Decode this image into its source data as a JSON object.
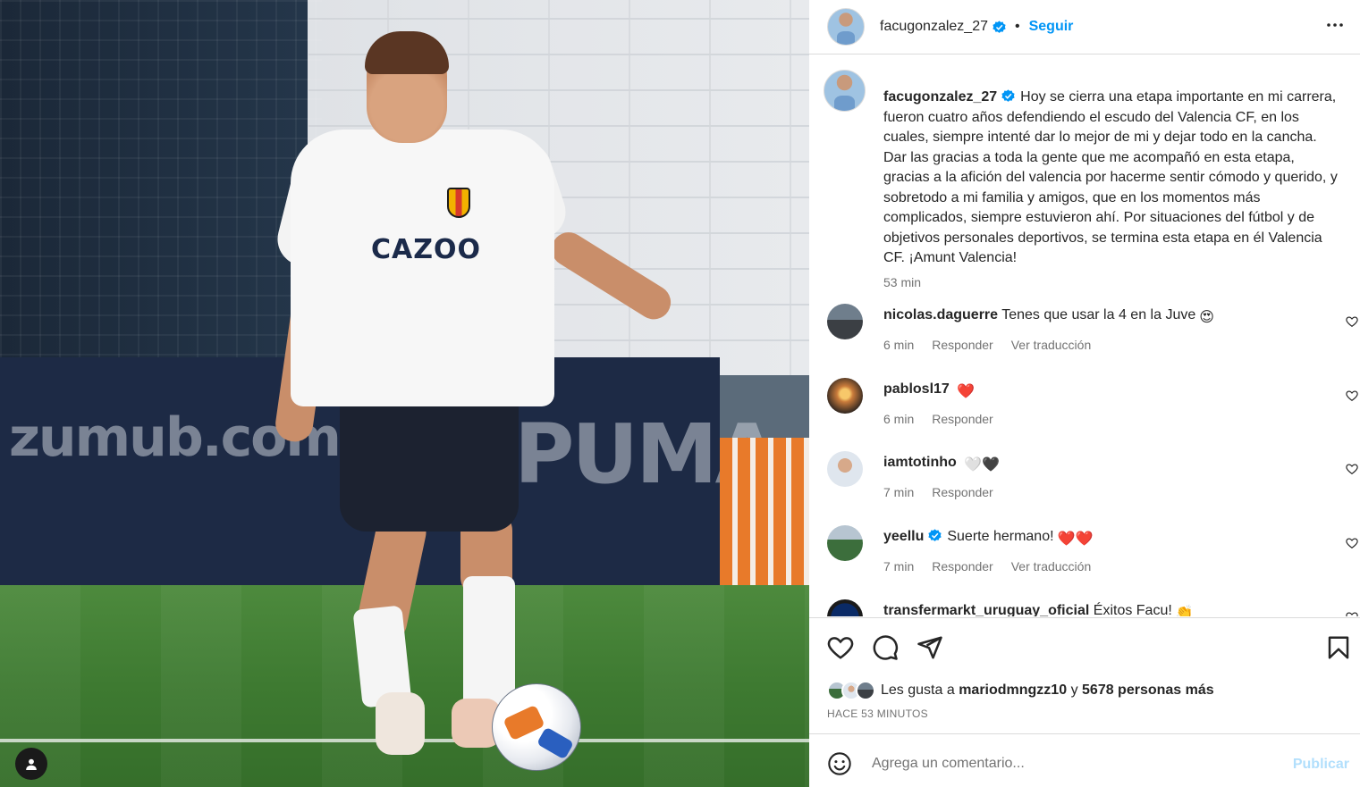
{
  "post": {
    "username": "facugonzalez_27",
    "follow_label": "Seguir",
    "separator": "•",
    "caption": "Hoy se cierra una etapa importante en mi carrera, fueron cuatro años defendiendo el escudo del Valencia CF, en los cuales, siempre intenté dar lo mejor de mi y dejar todo en la cancha. Dar las gracias a toda la gente que me acompañó en esta etapa, gracias a la afición del valencia por hacerme sentir cómodo y querido, y sobretodo a mi familia y amigos, que en los momentos más complicados, siempre estuvieron ahí. Por situaciones del fútbol y de objetivos personales deportivos, se termina esta etapa en él Valencia CF. ¡Amunt Valencia!",
    "caption_time": "53 min"
  },
  "photo": {
    "sponsor": "CAZOO",
    "ad_left": "zumub.com",
    "ad_right": "PUMA"
  },
  "comments": [
    {
      "username": "nicolas.daguerre",
      "text": "Tenes que usar la 4 en la Juve",
      "emoji": "😍",
      "time": "6 min",
      "reply": "Responder",
      "translate": "Ver traducción",
      "verified": false
    },
    {
      "username": "pablosl17",
      "text": "",
      "emoji": "❤️",
      "time": "6 min",
      "reply": "Responder",
      "translate": "",
      "verified": false
    },
    {
      "username": "iamtotinho",
      "text": "",
      "emoji": "🤍🖤",
      "time": "7 min",
      "reply": "Responder",
      "translate": "",
      "verified": false
    },
    {
      "username": "yeellu",
      "text": "Suerte hermano!",
      "emoji": "❤️❤️",
      "time": "7 min",
      "reply": "Responder",
      "translate": "Ver traducción",
      "verified": true
    },
    {
      "username": "transfermarkt_uruguay_oficial",
      "text": "Éxitos Facu!",
      "emoji": "👏",
      "time": "",
      "reply": "",
      "translate": "",
      "verified": false
    }
  ],
  "likes": {
    "prefix": "Les gusta a",
    "user": "mariodmngzz10",
    "joiner": "y",
    "others": "5678 personas más",
    "ago": "HACE 53 MINUTOS"
  },
  "composer": {
    "placeholder": "Agrega un comentario...",
    "publish_label": "Publicar"
  },
  "colors": {
    "accent": "#0095f6",
    "publish_disabled": "#b2dffc",
    "secondary_text": "#737373",
    "heart_red": "#ff3040"
  },
  "icons": [
    "verified-badge-icon",
    "more-options-icon",
    "heart-icon",
    "comment-icon",
    "share-icon",
    "bookmark-icon",
    "emoji-icon",
    "tagged-user-icon"
  ]
}
